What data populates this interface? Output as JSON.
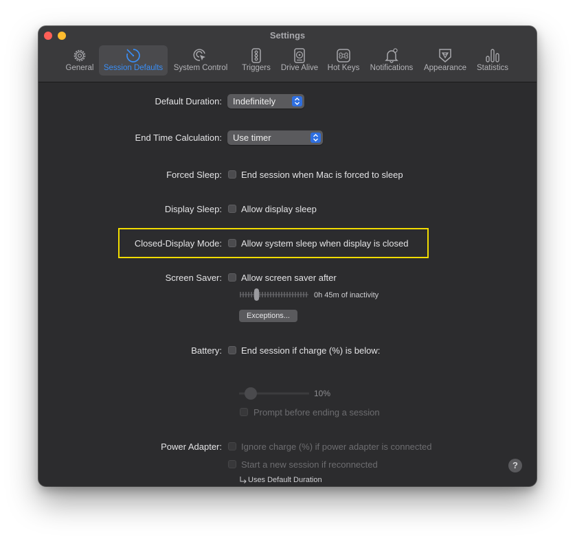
{
  "window": {
    "title": "Settings"
  },
  "tabs": [
    {
      "label": "General",
      "icon": "gear-icon"
    },
    {
      "label": "Session Defaults",
      "icon": "timer-icon"
    },
    {
      "label": "System Control",
      "icon": "cursor-click-icon"
    },
    {
      "label": "Triggers",
      "icon": "triggers-icon"
    },
    {
      "label": "Drive Alive",
      "icon": "drive-icon"
    },
    {
      "label": "Hot Keys",
      "icon": "command-key-icon"
    },
    {
      "label": "Notifications",
      "icon": "bell-icon"
    },
    {
      "label": "Appearance",
      "icon": "badge-icon"
    },
    {
      "label": "Statistics",
      "icon": "bar-chart-icon"
    }
  ],
  "active_tab": "Session Defaults",
  "colors": {
    "accent": "#3a8ef6",
    "highlight_box": "#f2dd00"
  },
  "settings": {
    "default_duration": {
      "label": "Default Duration:",
      "value": "Indefinitely"
    },
    "end_time_calc": {
      "label": "End Time Calculation:",
      "value": "Use timer"
    },
    "forced_sleep": {
      "label": "Forced Sleep:",
      "option": "End session when Mac is forced to sleep",
      "checked": false
    },
    "display_sleep": {
      "label": "Display Sleep:",
      "option": "Allow display sleep",
      "checked": false
    },
    "closed_display": {
      "label": "Closed-Display Mode:",
      "option": "Allow system sleep when display is closed",
      "checked": false
    },
    "screen_saver": {
      "label": "Screen Saver:",
      "option": "Allow screen saver after",
      "checked": false,
      "inactivity_text": "0h 45m of inactivity",
      "exceptions_button": "Exceptions..."
    },
    "battery": {
      "label": "Battery:",
      "option": "End session if charge (%) is below:",
      "checked": false,
      "value_text": "10%",
      "prompt_option": "Prompt before ending a session"
    },
    "power_adapter": {
      "label": "Power Adapter:",
      "option1": "Ignore charge (%) if power adapter is connected",
      "option2": "Start a new session if reconnected",
      "note": "Uses Default Duration"
    },
    "help": "?"
  }
}
